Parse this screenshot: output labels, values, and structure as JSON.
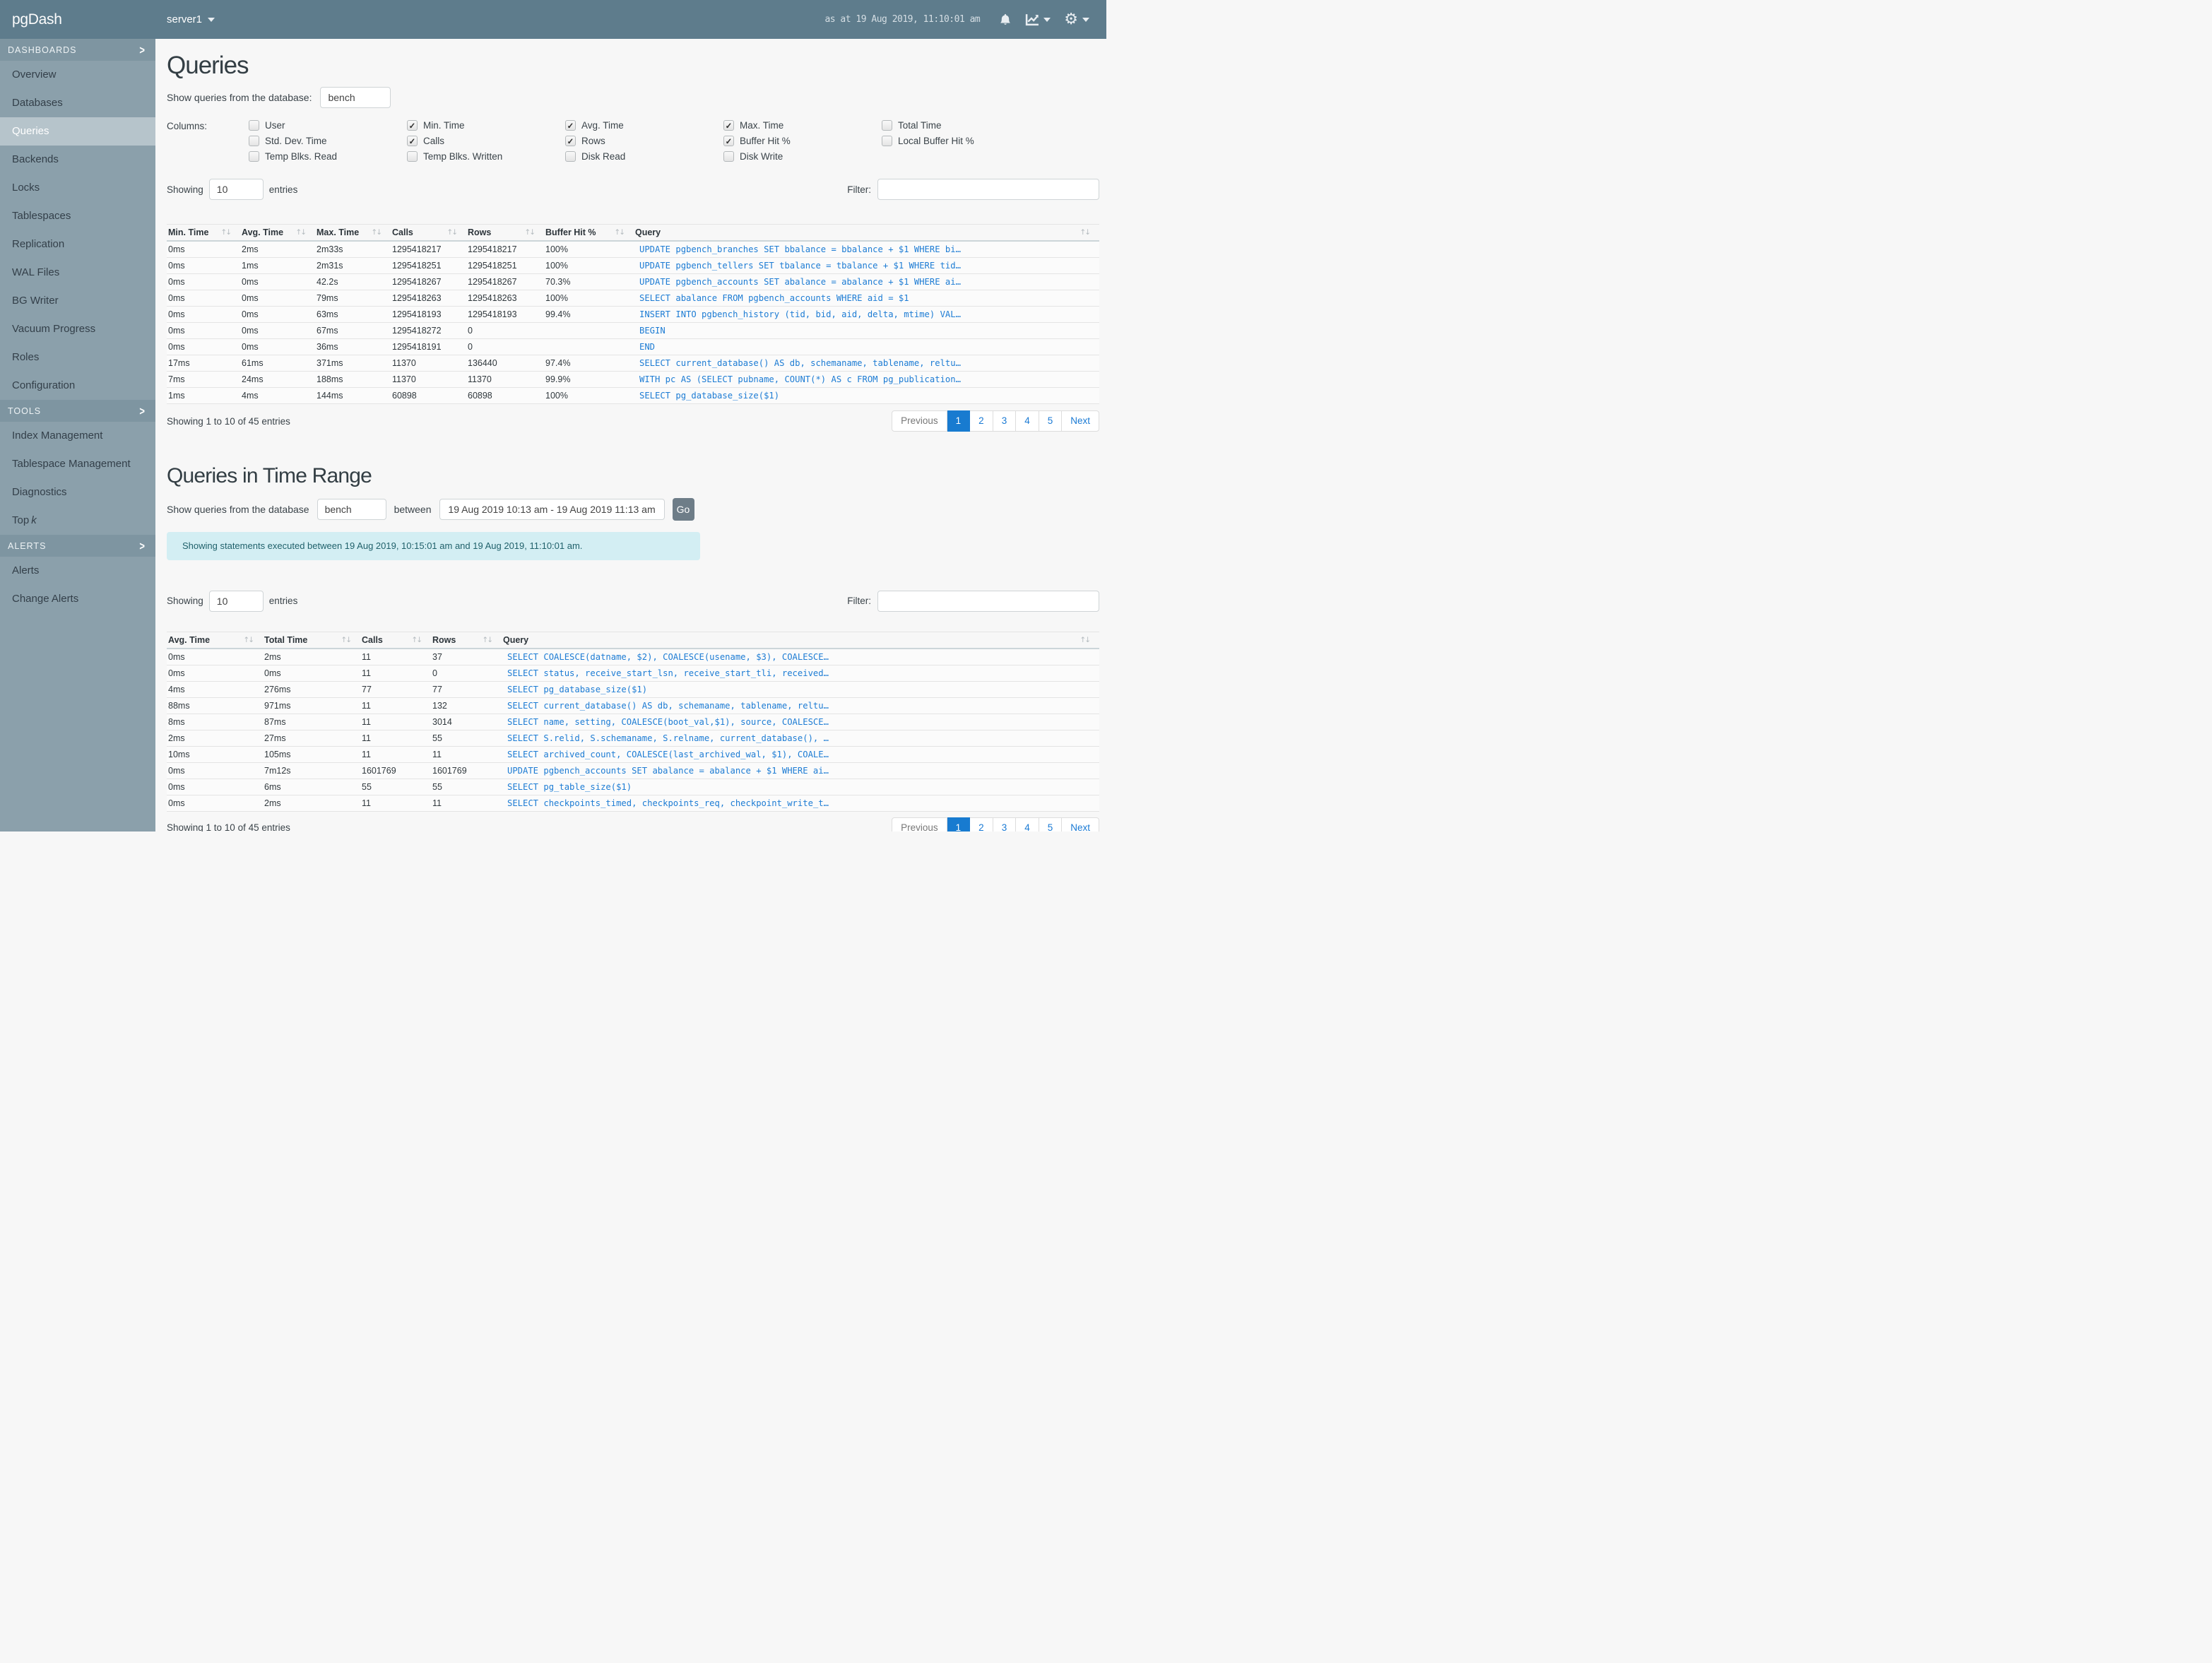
{
  "colors": {
    "topbar_bg": "#5e7c8c",
    "sidebar_bg": "#8ba0ab",
    "sidebar_section_bg": "#7e95a1",
    "sidebar_active_bg": "#b6c4cb",
    "link_blue": "#1d7cd4",
    "pagination_active_bg": "#187bd0",
    "notice_bg": "#d3eef3",
    "notice_text": "#20616b",
    "go_button_bg": "#6e7d88"
  },
  "topbar": {
    "brand": "pgDash",
    "server": "server1",
    "timestamp": "as at 19 Aug 2019, 11:10:01 am"
  },
  "sidebar": {
    "sections": [
      {
        "label": "DASHBOARDS",
        "items": [
          {
            "label": "Overview"
          },
          {
            "label": "Databases"
          },
          {
            "label": "Queries",
            "active": true
          },
          {
            "label": "Backends"
          },
          {
            "label": "Locks"
          },
          {
            "label": "Tablespaces"
          },
          {
            "label": "Replication"
          },
          {
            "label": "WAL Files"
          },
          {
            "label": "BG Writer"
          },
          {
            "label": "Vacuum Progress"
          },
          {
            "label": "Roles"
          },
          {
            "label": "Configuration"
          }
        ]
      },
      {
        "label": "TOOLS",
        "items": [
          {
            "label": "Index Management"
          },
          {
            "label": "Tablespace Management"
          },
          {
            "label": "Diagnostics"
          },
          {
            "label": "Top",
            "italic": "k"
          }
        ]
      },
      {
        "label": "ALERTS",
        "items": [
          {
            "label": "Alerts"
          },
          {
            "label": "Change Alerts"
          }
        ]
      }
    ]
  },
  "queries_section": {
    "title": "Queries",
    "db_label": "Show queries from the database:",
    "db_value": "bench",
    "columns_label": "Columns:",
    "checkbox_columns": [
      [
        {
          "label": "User",
          "checked": false
        },
        {
          "label": "Std. Dev. Time",
          "checked": false
        },
        {
          "label": "Temp Blks. Read",
          "checked": false
        }
      ],
      [
        {
          "label": "Min. Time",
          "checked": true
        },
        {
          "label": "Calls",
          "checked": true
        },
        {
          "label": "Temp Blks. Written",
          "checked": false
        }
      ],
      [
        {
          "label": "Avg. Time",
          "checked": true
        },
        {
          "label": "Rows",
          "checked": true
        },
        {
          "label": "Disk Read",
          "checked": false
        }
      ],
      [
        {
          "label": "Max. Time",
          "checked": true
        },
        {
          "label": "Buffer Hit %",
          "checked": true
        },
        {
          "label": "Disk Write",
          "checked": false
        }
      ],
      [
        {
          "label": "Total Time",
          "checked": false
        },
        {
          "label": "Local Buffer Hit %",
          "checked": false
        }
      ]
    ],
    "showing_label": "Showing",
    "page_size": "10",
    "entries_label": "entries",
    "filter_label": "Filter:",
    "filter_value": "",
    "table": {
      "headers": [
        "Min. Time",
        "Avg. Time",
        "Max. Time",
        "Calls",
        "Rows",
        "Buffer Hit %",
        "Query"
      ],
      "rows": [
        [
          "0ms",
          "2ms",
          "2m33s",
          "1295418217",
          "1295418217",
          "100%",
          "UPDATE pgbench_branches SET bbalance = bbalance + $1 WHERE bi…"
        ],
        [
          "0ms",
          "1ms",
          "2m31s",
          "1295418251",
          "1295418251",
          "100%",
          "UPDATE pgbench_tellers SET tbalance = tbalance + $1 WHERE tid…"
        ],
        [
          "0ms",
          "0ms",
          "42.2s",
          "1295418267",
          "1295418267",
          "70.3%",
          "UPDATE pgbench_accounts SET abalance = abalance + $1 WHERE ai…"
        ],
        [
          "0ms",
          "0ms",
          "79ms",
          "1295418263",
          "1295418263",
          "100%",
          "SELECT abalance FROM pgbench_accounts WHERE aid = $1"
        ],
        [
          "0ms",
          "0ms",
          "63ms",
          "1295418193",
          "1295418193",
          "99.4%",
          "INSERT INTO pgbench_history (tid, bid, aid, delta, mtime) VAL…"
        ],
        [
          "0ms",
          "0ms",
          "67ms",
          "1295418272",
          "0",
          "",
          "BEGIN"
        ],
        [
          "0ms",
          "0ms",
          "36ms",
          "1295418191",
          "0",
          "",
          "END"
        ],
        [
          "17ms",
          "61ms",
          "371ms",
          "11370",
          "136440",
          "97.4%",
          "SELECT current_database() AS db, schemaname, tablename, reltu…"
        ],
        [
          "7ms",
          "24ms",
          "188ms",
          "11370",
          "11370",
          "99.9%",
          "WITH pc AS (SELECT pubname, COUNT(*) AS c FROM pg_publication…"
        ],
        [
          "1ms",
          "4ms",
          "144ms",
          "60898",
          "60898",
          "100%",
          "SELECT pg_database_size($1)"
        ]
      ]
    },
    "summary": "Showing 1 to 10 of 45 entries",
    "pagination": {
      "previous": "Previous",
      "pages": [
        "1",
        "2",
        "3",
        "4",
        "5"
      ],
      "active_page": "1",
      "next": "Next"
    }
  },
  "time_range_section": {
    "title": "Queries in Time Range",
    "db_label": "Show queries from the database",
    "db_value": "bench",
    "between_label": "between",
    "range_value": "19 Aug 2019 10:13 am - 19 Aug 2019 11:13 am",
    "go_label": "Go",
    "notice": "Showing statements executed between 19 Aug 2019, 10:15:01 am and 19 Aug 2019, 11:10:01 am.",
    "showing_label": "Showing",
    "page_size": "10",
    "entries_label": "entries",
    "filter_label": "Filter:",
    "filter_value": "",
    "table": {
      "headers": [
        "Avg. Time",
        "Total Time",
        "Calls",
        "Rows",
        "Query"
      ],
      "rows": [
        [
          "0ms",
          "2ms",
          "11",
          "37",
          "SELECT COALESCE(datname, $2), COALESCE(usename, $3), COALESCE…"
        ],
        [
          "0ms",
          "0ms",
          "11",
          "0",
          "SELECT status, receive_start_lsn, receive_start_tli, received…"
        ],
        [
          "4ms",
          "276ms",
          "77",
          "77",
          "SELECT pg_database_size($1)"
        ],
        [
          "88ms",
          "971ms",
          "11",
          "132",
          "SELECT current_database() AS db, schemaname, tablename, reltu…"
        ],
        [
          "8ms",
          "87ms",
          "11",
          "3014",
          "SELECT name, setting, COALESCE(boot_val,$1), source, COALESCE…"
        ],
        [
          "2ms",
          "27ms",
          "11",
          "55",
          "SELECT S.relid, S.schemaname, S.relname, current_database(), …"
        ],
        [
          "10ms",
          "105ms",
          "11",
          "11",
          "SELECT archived_count, COALESCE(last_archived_wal, $1), COALE…"
        ],
        [
          "0ms",
          "7m12s",
          "1601769",
          "1601769",
          "UPDATE pgbench_accounts SET abalance = abalance + $1 WHERE ai…"
        ],
        [
          "0ms",
          "6ms",
          "55",
          "55",
          "SELECT pg_table_size($1)"
        ],
        [
          "0ms",
          "2ms",
          "11",
          "11",
          "SELECT checkpoints_timed, checkpoints_req, checkpoint_write_t…"
        ]
      ]
    },
    "summary": "Showing 1 to 10 of 45 entries",
    "pagination": {
      "previous": "Previous",
      "pages": [
        "1",
        "2",
        "3",
        "4",
        "5"
      ],
      "active_page": "1",
      "next": "Next"
    }
  }
}
